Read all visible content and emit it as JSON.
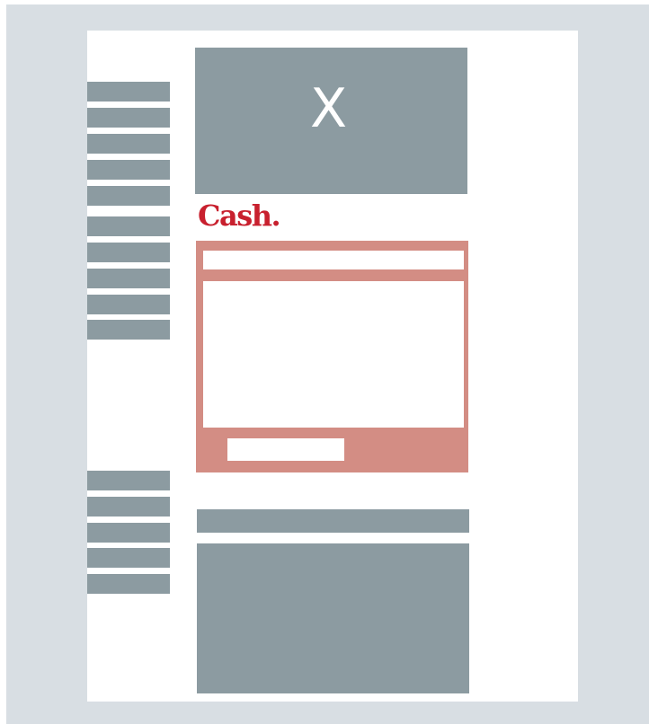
{
  "colors": {
    "frame": "#d8dee3",
    "page": "#ffffff",
    "gray_block": "#8c9ba1",
    "widget": "#d38d84",
    "brand": "#c8202e"
  },
  "hero": {
    "mark": "X"
  },
  "brand": {
    "logo_text": "Cash."
  },
  "icons": {
    "hero_mark": "close-x-icon"
  }
}
